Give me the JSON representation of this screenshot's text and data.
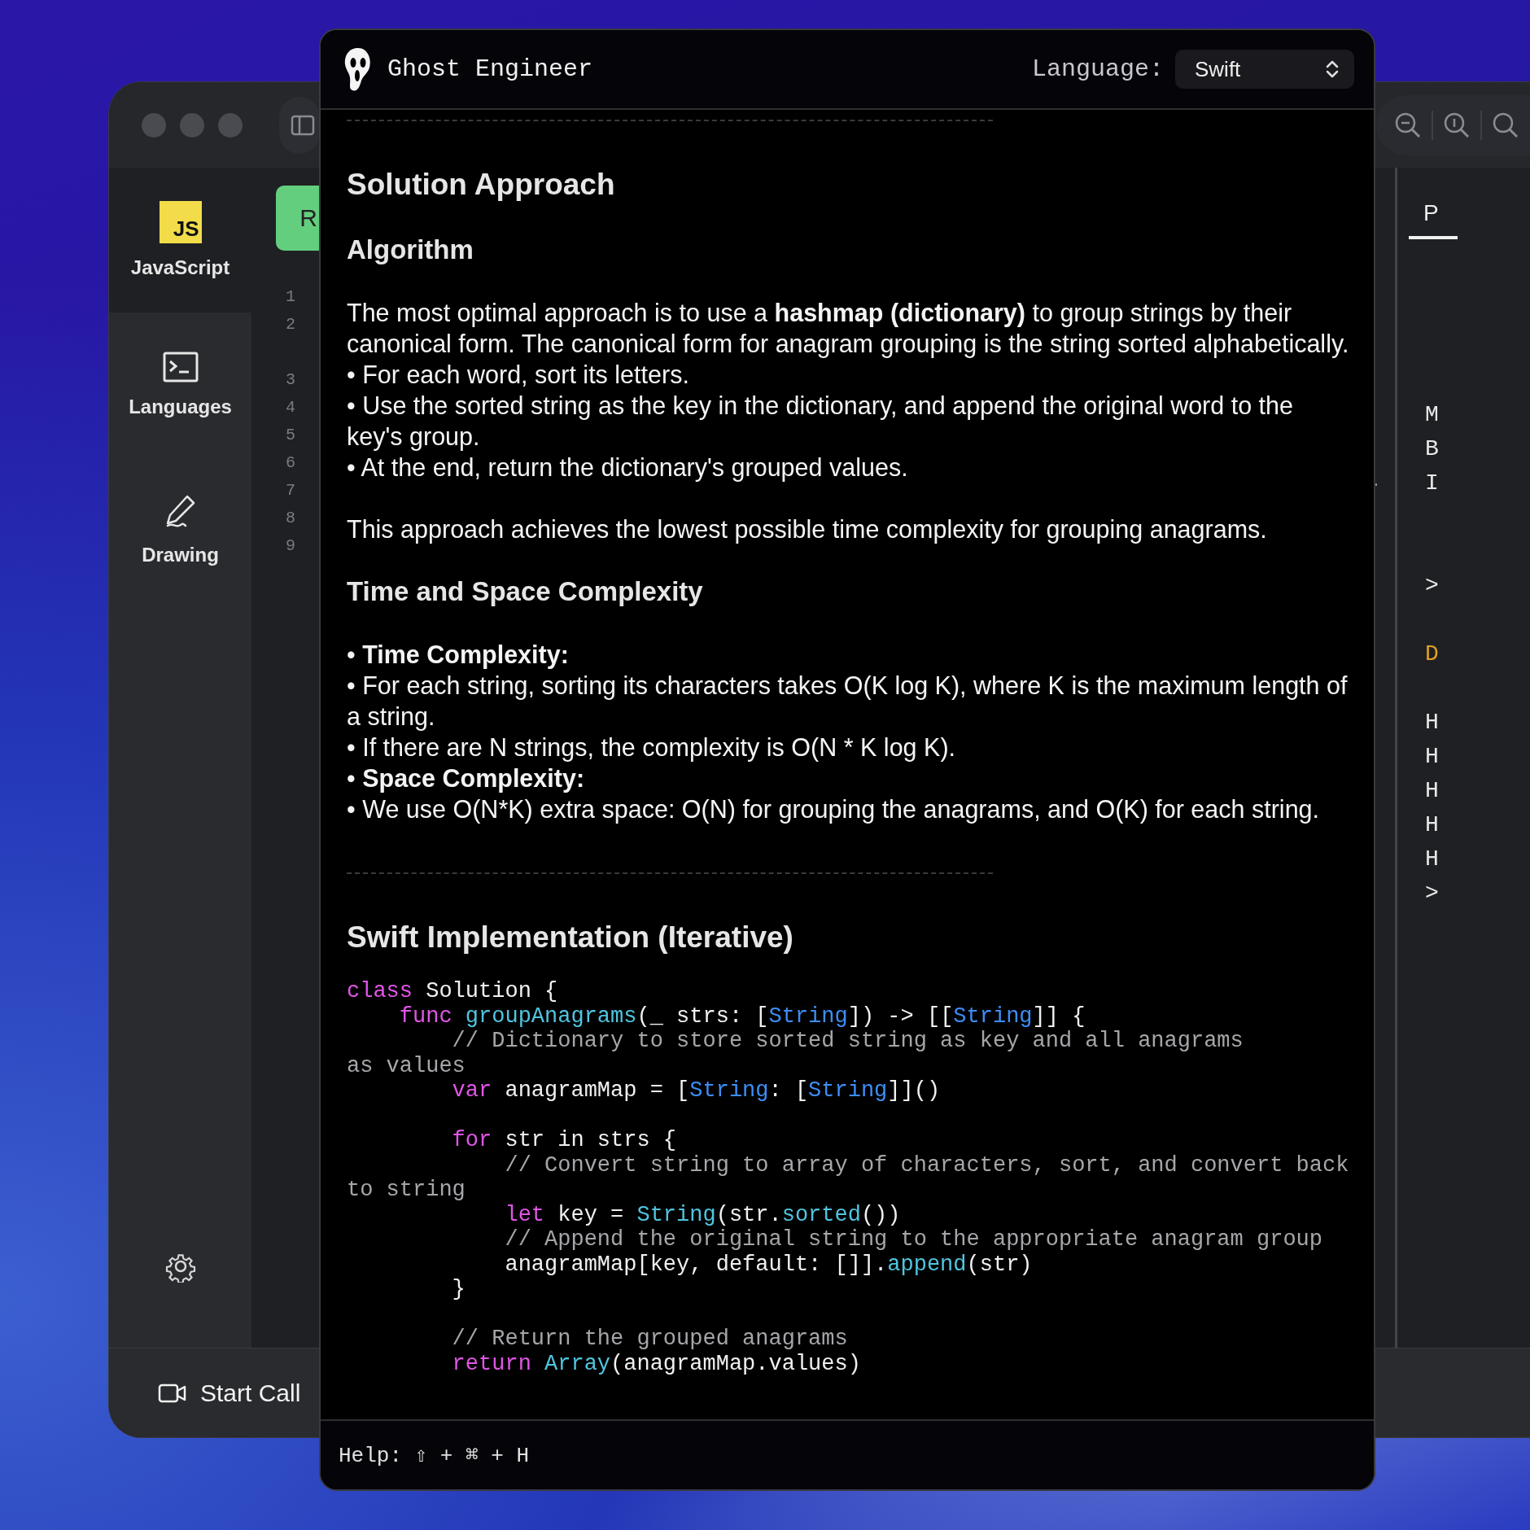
{
  "back_window": {
    "sidebar": {
      "items": [
        {
          "kind": "js",
          "badge": "JS",
          "label": "JavaScript",
          "selected": true
        },
        {
          "kind": "terminal",
          "label": "Languages",
          "selected": false
        },
        {
          "kind": "pen",
          "label": "Drawing",
          "selected": false
        }
      ]
    },
    "editor": {
      "run_button": "R",
      "line_numbers": [
        {
          "kind": "number",
          "number": "1"
        },
        {
          "kind": "number",
          "number": "2"
        },
        {
          "kind": "blank"
        },
        {
          "kind": "number",
          "number": "3"
        },
        {
          "kind": "number",
          "number": "4"
        },
        {
          "kind": "number",
          "number": "5"
        },
        {
          "kind": "number",
          "number": "6"
        },
        {
          "kind": "number",
          "number": "7"
        },
        {
          "kind": "number",
          "number": "8"
        },
        {
          "kind": "number",
          "number": "9"
        }
      ]
    },
    "right_panel": {
      "tab": "P",
      "lines": [
        {
          "kind": "text",
          "text": "M"
        },
        {
          "kind": "text",
          "text": "B"
        },
        {
          "kind": "text",
          "text": "I"
        },
        {
          "kind": "blank"
        },
        {
          "kind": "blank"
        },
        {
          "kind": "text",
          "text": ">"
        },
        {
          "kind": "blank"
        },
        {
          "kind": "warning",
          "text": "D"
        },
        {
          "kind": "blank"
        },
        {
          "kind": "text",
          "text": "H"
        },
        {
          "kind": "text",
          "text": "H"
        },
        {
          "kind": "text",
          "text": "H"
        },
        {
          "kind": "text",
          "text": "H"
        },
        {
          "kind": "text",
          "text": "H"
        },
        {
          "kind": "text",
          "text": ">"
        }
      ]
    },
    "bottom_bar": {
      "call_button": "Start Call"
    }
  },
  "overlay": {
    "title": "Ghost Engineer",
    "language_label": "Language:",
    "language": "Swift",
    "blocks": [
      {
        "kind": "rule"
      },
      {
        "kind": "h1",
        "text": "Solution Approach"
      },
      {
        "kind": "h2",
        "text": "Algorithm"
      },
      {
        "kind": "p",
        "text": "The most optimal approach is to use a **hashmap (dictionary)** to group strings by their canonical form. The canonical form for anagram grouping is the string sorted alphabetically."
      },
      {
        "kind": "bullet",
        "text": "• For each word, sort its letters."
      },
      {
        "kind": "bullet",
        "text": "• Use the sorted string as the key in the dictionary, and append the original word to the key's group."
      },
      {
        "kind": "bullet",
        "text": "• At the end, return the dictionary's grouped values."
      },
      {
        "kind": "p",
        "text": "This approach achieves the lowest possible time complexity for grouping anagrams."
      },
      {
        "kind": "h2",
        "text": "Time and Space Complexity"
      },
      {
        "kind": "bullet",
        "text": "• **Time Complexity:**"
      },
      {
        "kind": "bullet",
        "text": "• For each string, sorting its characters takes O(K log K), where K is the maximum length of a string."
      },
      {
        "kind": "bullet",
        "text": "• If there are N strings, the complexity is O(N * K log K)."
      },
      {
        "kind": "bullet",
        "text": "• **Space Complexity:**"
      },
      {
        "kind": "bullet",
        "text": "• We use O(N*K) extra space: O(N) for grouping the anagrams, and O(K) for each string."
      },
      {
        "kind": "rule"
      },
      {
        "kind": "h1",
        "text": "Swift Implementation (Iterative)"
      },
      {
        "kind": "code",
        "lines": [
          {
            "kind": "code",
            "tokens": [
              {
                "kind": "kw",
                "text": "class"
              },
              {
                "kind": "plain",
                "text": " Solution {"
              }
            ]
          },
          {
            "kind": "code",
            "tokens": [
              {
                "kind": "kw",
                "text": "    func"
              },
              {
                "kind": "fn",
                "text": " groupAnagrams"
              },
              {
                "kind": "plain",
                "text": "(_ strs: ["
              },
              {
                "kind": "type",
                "text": "String"
              },
              {
                "kind": "plain",
                "text": "]) -> [["
              },
              {
                "kind": "type",
                "text": "String"
              },
              {
                "kind": "plain",
                "text": "]] {"
              }
            ]
          },
          {
            "kind": "code",
            "tokens": [
              {
                "kind": "comment",
                "text": "        // Dictionary to store sorted string as key and all anagrams"
              }
            ]
          },
          {
            "kind": "code",
            "tokens": [
              {
                "kind": "comment",
                "text": "as values"
              }
            ]
          },
          {
            "kind": "code",
            "tokens": [
              {
                "kind": "kw",
                "text": "        var"
              },
              {
                "kind": "plain",
                "text": " anagramMap = ["
              },
              {
                "kind": "type",
                "text": "String"
              },
              {
                "kind": "plain",
                "text": ": ["
              },
              {
                "kind": "type",
                "text": "String"
              },
              {
                "kind": "plain",
                "text": "]]()"
              }
            ]
          },
          {
            "kind": "blank"
          },
          {
            "kind": "code",
            "tokens": [
              {
                "kind": "kw",
                "text": "        for"
              },
              {
                "kind": "plain",
                "text": " str in strs {"
              }
            ]
          },
          {
            "kind": "code",
            "tokens": [
              {
                "kind": "comment",
                "text": "            // Convert string to array of characters, sort, and convert back"
              }
            ]
          },
          {
            "kind": "code",
            "tokens": [
              {
                "kind": "comment",
                "text": "to string"
              }
            ]
          },
          {
            "kind": "code",
            "tokens": [
              {
                "kind": "kw",
                "text": "            let"
              },
              {
                "kind": "plain",
                "text": " key = "
              },
              {
                "kind": "fn",
                "text": "String"
              },
              {
                "kind": "plain",
                "text": "(str."
              },
              {
                "kind": "fn",
                "text": "sorted"
              },
              {
                "kind": "plain",
                "text": "())"
              }
            ]
          },
          {
            "kind": "code",
            "tokens": [
              {
                "kind": "comment",
                "text": "            // Append the original string to the appropriate anagram group"
              }
            ]
          },
          {
            "kind": "code",
            "tokens": [
              {
                "kind": "plain",
                "text": "            anagramMap[key, default: []]."
              },
              {
                "kind": "fn",
                "text": "append"
              },
              {
                "kind": "plain",
                "text": "(str)"
              }
            ]
          },
          {
            "kind": "code",
            "tokens": [
              {
                "kind": "plain",
                "text": "        }"
              }
            ]
          },
          {
            "kind": "blank"
          },
          {
            "kind": "code",
            "tokens": [
              {
                "kind": "comment",
                "text": "        // Return the grouped anagrams"
              }
            ]
          },
          {
            "kind": "code",
            "tokens": [
              {
                "kind": "kw",
                "text": "        return"
              },
              {
                "kind": "fn",
                "text": " Array"
              },
              {
                "kind": "plain",
                "text": "(anagramMap.values)"
              }
            ]
          }
        ]
      }
    ],
    "help": "Help: ⇧ + ⌘ + H"
  }
}
